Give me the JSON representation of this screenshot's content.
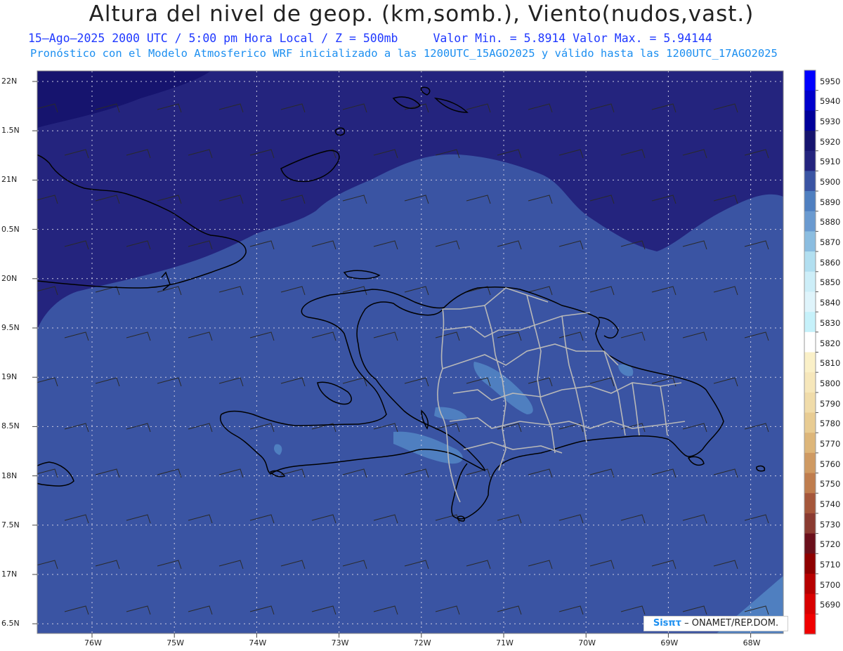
{
  "header": {
    "title": "Altura del nivel de geop. (km,somb.), Viento(nudos,vast.)",
    "subtitle_left": "15–Ago–2025  2000 UTC / 5:00 pm Hora Local / Z = 500mb",
    "subtitle_right": "Valor Min. = 5.8914  Valor Max. = 5.94144",
    "line3": "Pronóstico con el Modelo Atmosferico WRF inicializado a las 1200UTC_15AGO2025 y válido hasta las  1200UTC_17AGO2025"
  },
  "map": {
    "lat_labels": [
      "22N",
      "1.5N",
      "21N",
      "0.5N",
      "20N",
      "9.5N",
      "19N",
      "8.5N",
      "18N",
      "7.5N",
      "17N",
      "6.5N"
    ],
    "lon_labels": [
      "76W",
      "75W",
      "74W",
      "73W",
      "72W",
      "71W",
      "70W",
      "69W",
      "68W"
    ],
    "colors": {
      "level_5910": "#24247e",
      "level_5900": "#3a54a3",
      "level_5890": "#4f7fc0",
      "coastline": "#000000",
      "borders": "#b8b8b8",
      "grid": "#c8c8e0"
    }
  },
  "colorbar": {
    "labels": [
      "5950",
      "5940",
      "5930",
      "5920",
      "5910",
      "5900",
      "5890",
      "5880",
      "5870",
      "5860",
      "5850",
      "5840",
      "5830",
      "5820",
      "5810",
      "5800",
      "5790",
      "5780",
      "5770",
      "5760",
      "5750",
      "5740",
      "5730",
      "5720",
      "5710",
      "5700",
      "5690"
    ],
    "colors": [
      "#0000ff",
      "#0000cc",
      "#00009a",
      "#16146e",
      "#24247e",
      "#3a54a3",
      "#4f7fc0",
      "#6a9ad0",
      "#8bbde0",
      "#b2dff0",
      "#cdeef8",
      "#dff4fb",
      "#c6f1fa",
      "#ffffff",
      "#faf0c8",
      "#f6e7bb",
      "#f0dcaa",
      "#e8cc93",
      "#ddb67a",
      "#cf9a63",
      "#bf7d4e",
      "#a5573b",
      "#8a3b31",
      "#6a0f1b",
      "#8e0000",
      "#b60000",
      "#d80000",
      "#f00000"
    ]
  },
  "credit": {
    "brand": "Sisπτ",
    "text": " – ONAMET/REP.DOM."
  }
}
